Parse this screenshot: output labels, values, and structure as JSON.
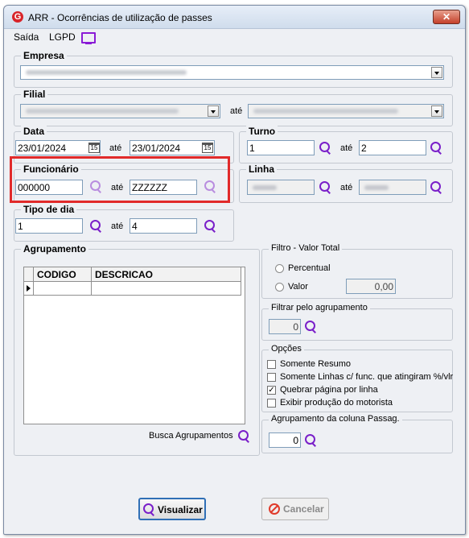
{
  "window": {
    "title": "ARR - Ocorrências de utilização de passes",
    "close_label": "✕"
  },
  "menu": {
    "saida": "Saída",
    "lgpd": "LGPD"
  },
  "empresa": {
    "label": "Empresa"
  },
  "filial": {
    "label": "Filial",
    "ate": "até"
  },
  "data": {
    "label": "Data",
    "from": "23/01/2024",
    "to": "23/01/2024",
    "ate": "até",
    "cal_label": "15"
  },
  "turno": {
    "label": "Turno",
    "from": "1",
    "to": "2",
    "ate": "até"
  },
  "funcionario": {
    "label": "Funcionário",
    "from": "000000",
    "to": "ZZZZZZ",
    "ate": "até"
  },
  "linha": {
    "label": "Linha",
    "ate": "até"
  },
  "tipo_dia": {
    "label": "Tipo de dia",
    "from": "1",
    "to": "4",
    "ate": "até"
  },
  "agrupamento": {
    "label": "Agrupamento",
    "columns": [
      "CODIGO",
      "DESCRICAO"
    ],
    "busca_label": "Busca Agrupamentos"
  },
  "filtro_valor": {
    "label": "Filtro - Valor Total",
    "options": [
      "Percentual",
      "Valor"
    ],
    "value": "0,00"
  },
  "filtrar_agrupamento": {
    "label": "Filtrar pelo agrupamento",
    "value": "0"
  },
  "opcoes": {
    "label": "Opções",
    "items": [
      {
        "label": "Somente Resumo",
        "checked": false
      },
      {
        "label": "Somente Linhas c/ func. que atingiram %/vlr",
        "checked": false
      },
      {
        "label": "Quebrar página por linha",
        "checked": true
      },
      {
        "label": "Exibir produção do motorista",
        "checked": false
      }
    ]
  },
  "agrupamento_coluna": {
    "label": "Agrupamento  da coluna Passag.",
    "value": "0"
  },
  "buttons": {
    "visualizar": "Visualizar",
    "cancelar": "Cancelar"
  },
  "colors": {
    "accent": "#7a1fc9",
    "highlight": "#e12a2a"
  },
  "icons": [
    "app-logo-icon",
    "close-icon",
    "monitor-icon",
    "calendar-icon",
    "search-icon",
    "cancel-icon",
    "row-pointer-icon"
  ]
}
